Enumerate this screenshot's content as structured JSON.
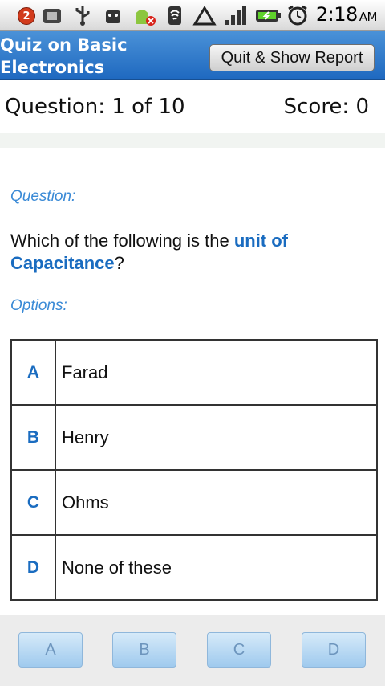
{
  "status_bar": {
    "notification_count": "2",
    "time": "2:18",
    "ampm": "AM",
    "icons": [
      "notification-badge-icon",
      "sim-card-icon",
      "usb-icon",
      "android-debug-icon",
      "android-error-icon",
      "wifi-icon",
      "warning-triangle-icon",
      "signal-icon",
      "battery-charging-icon",
      "alarm-icon"
    ]
  },
  "header": {
    "title_line1": "Quiz on Basic",
    "title_line2": "Electronics",
    "quit_button": "Quit & Show Report"
  },
  "info": {
    "question_count": "Question: 1 of 10",
    "score": "Score: 0"
  },
  "question": {
    "label": "Question:",
    "text_before": "Which of the following is the ",
    "text_highlight": "unit of Capacitance",
    "text_after": "?"
  },
  "options": {
    "label": "Options:",
    "items": [
      {
        "letter": "A",
        "text": "Farad"
      },
      {
        "letter": "B",
        "text": "Henry"
      },
      {
        "letter": "C",
        "text": "Ohms"
      },
      {
        "letter": "D",
        "text": "None of these"
      }
    ]
  },
  "answer_buttons": [
    "A",
    "B",
    "C",
    "D"
  ],
  "colors": {
    "header_blue": "#2b76c8",
    "accent_blue": "#1a6cc0",
    "label_blue": "#3a8ad6"
  }
}
